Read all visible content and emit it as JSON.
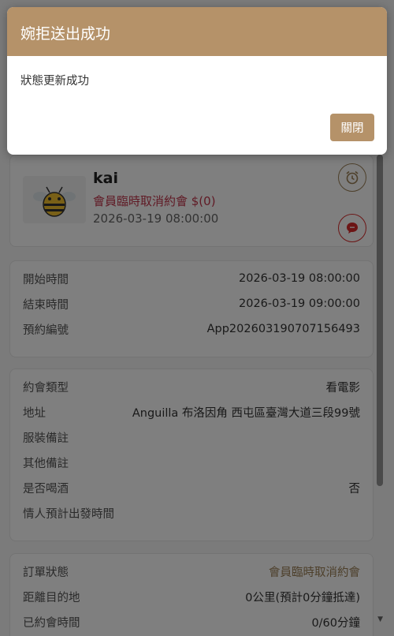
{
  "dialog": {
    "title": "婉拒送出成功",
    "message": "狀態更新成功",
    "close_label": "關閉"
  },
  "profile": {
    "name": "kai",
    "status": "會員臨時取消約會 $(0)",
    "time": "2026-03-19 08:00:00",
    "alarm_icon": "alarm-clock-icon",
    "message_icon": "chat-bubble-icon"
  },
  "times": [
    {
      "label": "開始時間",
      "value": "2026-03-19 08:00:00"
    },
    {
      "label": "結束時間",
      "value": "2026-03-19 09:00:00"
    },
    {
      "label": "預約編號",
      "value": "App202603190707156493"
    }
  ],
  "details": [
    {
      "label": "約會類型",
      "value": "看電影"
    },
    {
      "label": "地址",
      "value": "Anguilla 布洛因角 西屯區臺灣大道三段99號"
    },
    {
      "label": "服裝備註",
      "value": ""
    },
    {
      "label": "其他備註",
      "value": ""
    },
    {
      "label": "是否喝酒",
      "value": "否"
    },
    {
      "label": "情人預計出發時間",
      "value": ""
    }
  ],
  "order": [
    {
      "label": "訂單狀態",
      "value": "會員臨時取消約會"
    },
    {
      "label": "距離目的地",
      "value": "0公里(預計0分鐘抵達)"
    },
    {
      "label": "已約會時間",
      "value": "0/60分鐘"
    }
  ],
  "colors": {
    "accent": "#b59269",
    "status_red": "#c0354a"
  }
}
